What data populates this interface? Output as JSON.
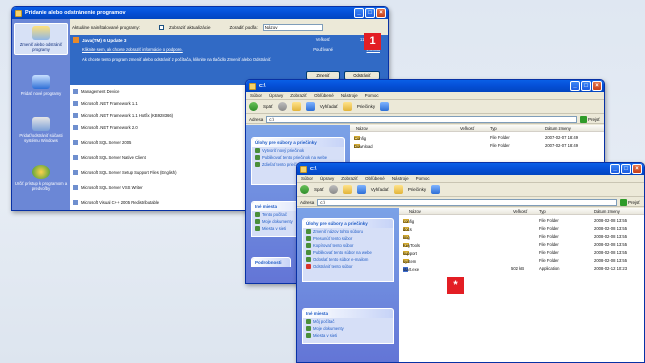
{
  "win1": {
    "title": "Pridanie alebo odstránenie programov",
    "header": {
      "installed_label": "Aktuálne nainštalované programy:",
      "show_updates_label": "Zobraziť aktualizácie",
      "sort_label": "Zoradiť podľa:",
      "sort_value": "Názov"
    },
    "left_nav": [
      {
        "label": "Zmeniť alebo odstrániť programy"
      },
      {
        "label": "Pridať nové programy"
      },
      {
        "label": "Pridať/odstrániť súčasti systému Windows"
      },
      {
        "label": "Určiť prístup k programom a predvoľby"
      }
    ],
    "selected": {
      "name": "Java(TM) 6 Update 3",
      "size_label": "Veľkosť",
      "size_value": "117,00 MB",
      "support_link": "Kliknite sem, ak chcete zobraziť informácie o podpore.",
      "used_label": "Používané",
      "used_value": "zriedka",
      "hint": "Ak chcete tento program zmeniť alebo odstrániť z počítača, kliknite na tlačidlo Zmeniť alebo Odstrániť.",
      "btn_change": "Zmeniť",
      "btn_remove": "Odstrániť"
    },
    "programs": [
      "Management Device",
      "Microsoft .NET Framework 1.1",
      "Microsoft .NET Framework 1.1 Hotfix (KB928366)",
      "Microsoft .NET Framework 2.0",
      "Microsoft SQL Server 2005",
      "Microsoft SQL Server Native Client",
      "Microsoft SQL Server Setup Support Files (English)",
      "Microsoft SQL Server VSS Writer",
      "Microsoft Visual C++ 2005 Redistributable"
    ]
  },
  "win2": {
    "title": "c:\\",
    "menu": [
      "Súbor",
      "Úpravy",
      "Zobraziť",
      "Obľúbené",
      "Nástroje",
      "Pomoc"
    ],
    "toolbar": {
      "back": "Späť",
      "search": "Vyhľadať",
      "folders": "Priečinky"
    },
    "address_label": "Adresa",
    "address_value": "c:\\",
    "go_label": "Prejsť",
    "task_title": "Úlohy pre súbory a priečinky",
    "tasks": [
      "Vytvoriť nový priečinok",
      "Publikovať tento priečinok na webe",
      "Zdieľať tento priečinok"
    ],
    "other_title": "Iné miesta",
    "other_items": [
      "Tento počítač",
      "Moje dokumenty",
      "Miesta v sieti"
    ],
    "details_title": "Podrobnosti",
    "columns": {
      "name": "Názov",
      "size": "Veľkosť",
      "type": "Typ",
      "date": "Dátum zmeny"
    },
    "rows": [
      {
        "name": "Config",
        "type": "File Folder",
        "date": "2007-02-07 18:49"
      },
      {
        "name": "Download",
        "type": "File Folder",
        "date": "2007-02-07 18:49"
      }
    ]
  },
  "win3": {
    "title": "c:\\",
    "menu": [
      "Súbor",
      "Úpravy",
      "Zobraziť",
      "Obľúbené",
      "Nástroje",
      "Pomoc"
    ],
    "toolbar": {
      "back": "Späť",
      "search": "Vyhľadať",
      "folders": "Priečinky"
    },
    "address_label": "Adresa",
    "address_value": "c:\\",
    "go_label": "Prejsť",
    "task_title": "Úlohy pre súbory a priečinky",
    "tasks": [
      "Zmeniť názov tohto súboru",
      "Presunúť tento súbor",
      "Kopírovať tento súbor",
      "Publikovať tento súbor na webe",
      "Odoslať tento súbor e-mailom",
      "Odstrániť tento súbor"
    ],
    "other_title": "Iné miesta",
    "other_items": [
      "Môj počítač",
      "Moje dokumenty",
      "Miesta v sieti"
    ],
    "columns": {
      "name": "Názov",
      "size": "Veľkosť",
      "type": "Typ",
      "date": "Dátum zmeny"
    },
    "rows": [
      {
        "name": "config",
        "size": "",
        "type": "File Folder",
        "date": "2008-02-08 13:55"
      },
      {
        "name": "docs",
        "size": "",
        "type": "File Folder",
        "date": "2008-02-08 13:55"
      },
      {
        "name": "img",
        "size": "",
        "type": "File Folder",
        "date": "2008-02-08 13:55"
      },
      {
        "name": "KeyTools",
        "size": "",
        "type": "File Folder",
        "date": "2008-02-08 13:55"
      },
      {
        "name": "support",
        "size": "",
        "type": "File Folder",
        "date": "2008-02-08 13:55"
      },
      {
        "name": "system",
        "size": "",
        "type": "File Folder",
        "date": "2008-02-08 13:55"
      },
      {
        "name": "start.exe",
        "size": "502 kB",
        "type": "Application",
        "date": "2008-02-12 10:23"
      }
    ]
  },
  "badges": {
    "one": "1",
    "star": "*"
  },
  "colors": {
    "xp_title": "#0550d8",
    "badge_red": "#e31e24",
    "taskpane": "#6375d6"
  }
}
